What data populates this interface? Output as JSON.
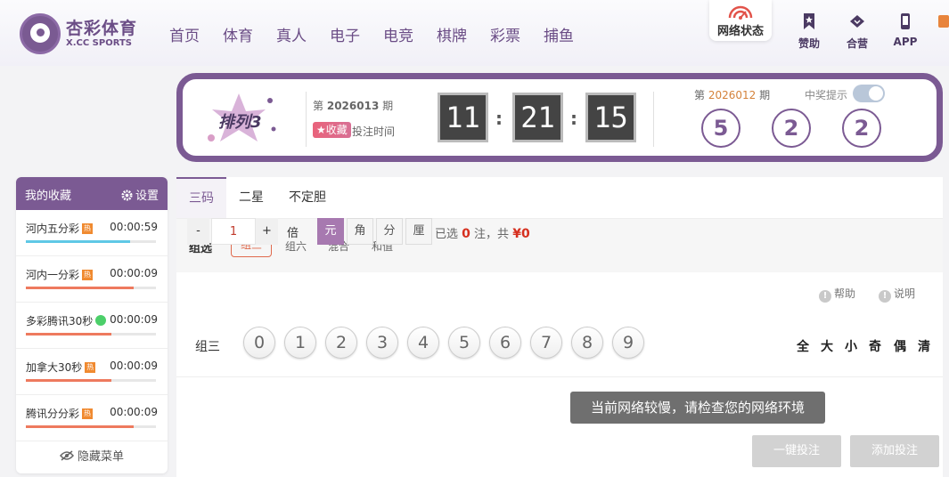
{
  "header": {
    "logo_cn": "杏彩体育",
    "logo_en": "X.CC SPORTS",
    "nav": [
      "首页",
      "体育",
      "真人",
      "电子",
      "电竞",
      "棋牌",
      "彩票",
      "捕鱼"
    ],
    "network_status": "网络状态",
    "icons": [
      {
        "label": "赞助",
        "icon": "bookmark-star-icon"
      },
      {
        "label": "合营",
        "icon": "diamond-heart-icon"
      },
      {
        "label": "APP",
        "icon": "phone-icon"
      }
    ]
  },
  "lottery": {
    "name": "排列3",
    "current_period_prefix": "第",
    "current_period": "2026013",
    "current_period_suffix": "期",
    "favorite_label": "★收藏",
    "bet_time_label": "投注时间",
    "countdown": {
      "hours": "11",
      "minutes": "21",
      "seconds": "15"
    },
    "last_period_prefix": "第",
    "last_period": "2026012",
    "last_period_suffix": "期",
    "prize_tip_label": "中奖提示",
    "prize_tip_on": true,
    "draw_numbers": [
      "5",
      "2",
      "2"
    ]
  },
  "favorites": {
    "title": "我的收藏",
    "settings_label": "设置",
    "items": [
      {
        "name": "河内五分彩",
        "badge": "热",
        "time": "00:00:59",
        "bar_color": "#5fc8e6",
        "progress": 0.8
      },
      {
        "name": "河内一分彩",
        "badge": "热",
        "time": "00:00:09",
        "bar_color": "#ee7a5e",
        "progress": 0.83
      },
      {
        "name": "多彩腾讯30秒",
        "badge": "",
        "time": "00:00:09",
        "bar_color": "#ee7a5e",
        "progress": 0.66
      },
      {
        "name": "加拿大30秒",
        "badge": "热",
        "time": "00:00:09",
        "bar_color": "#ee7a5e",
        "progress": 0.66
      },
      {
        "name": "腾讯分分彩",
        "badge": "热",
        "time": "00:00:09",
        "bar_color": "#ee7a5e",
        "progress": 0.83
      }
    ],
    "hide_menu_label": "隐藏菜单"
  },
  "play": {
    "tabs": [
      "三码",
      "二星",
      "不定胆"
    ],
    "active_tab": 0,
    "sub_label": "组选",
    "sub_options": [
      "组三",
      "组六",
      "混合",
      "和值"
    ],
    "active_sub": 0,
    "help_label": "帮助",
    "explain_label": "说明",
    "row_label": "组三",
    "balls": [
      "0",
      "1",
      "2",
      "3",
      "4",
      "5",
      "6",
      "7",
      "8",
      "9"
    ],
    "quick_select": [
      "全",
      "大",
      "小",
      "奇",
      "偶",
      "清"
    ],
    "multiplier_minus": "-",
    "multiplier_value": "1",
    "multiplier_plus": "+",
    "multiplier_label": "倍",
    "units": [
      "元",
      "角",
      "分",
      "厘"
    ],
    "active_unit": 0,
    "selected_prefix": "已选",
    "selected_count": "0",
    "selected_middle": "注，共",
    "total_amount": "¥0",
    "one_click_bet": "一键投注",
    "add_bet": "添加投注"
  },
  "toast": "当前网络较慢，请检查您的网络环境",
  "colors": {
    "brand": "#7b5a93",
    "accent_red": "#d6301f",
    "hot_badge": "#f08a30"
  }
}
